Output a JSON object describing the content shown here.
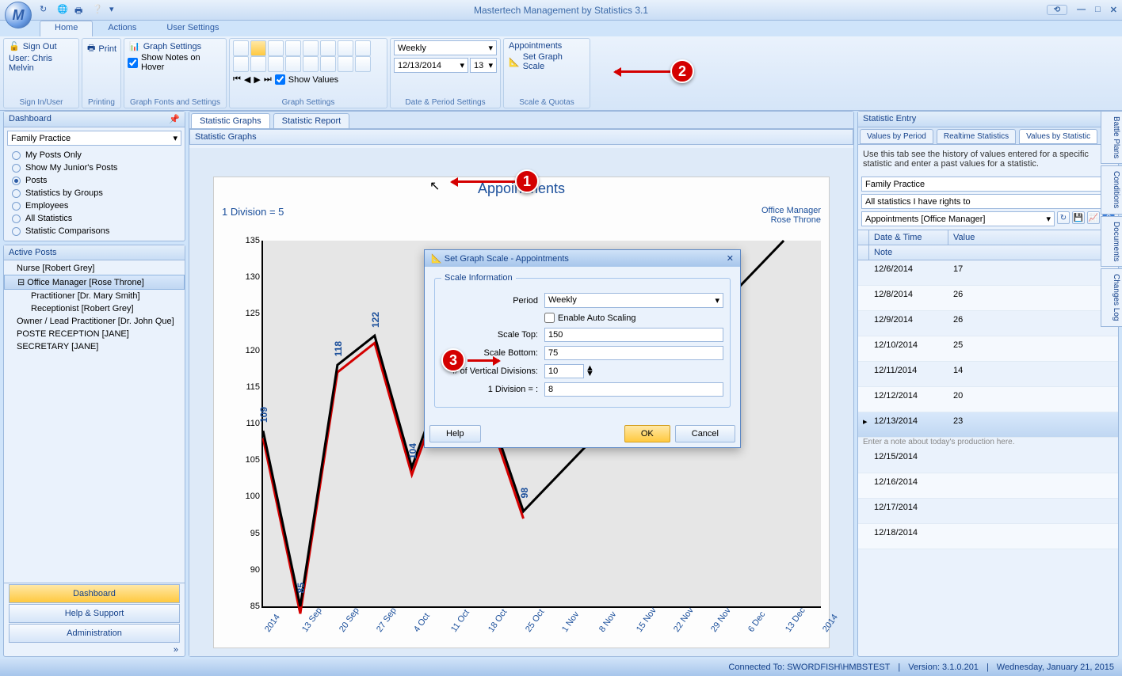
{
  "app": {
    "title": "Mastertech Management by Statistics 3.1",
    "orb": "M"
  },
  "tabs": {
    "home": "Home",
    "actions": "Actions",
    "user_settings": "User Settings"
  },
  "ribbon": {
    "sign_out": "Sign Out",
    "user_line": "User: Chris Melvin",
    "sign_in_grp": "Sign In/User",
    "print": "Print",
    "printing_grp": "Printing",
    "graph_settings": "Graph Settings",
    "show_notes": "Show Notes on Hover",
    "fonts_grp": "Graph Fonts and Settings",
    "show_values": "Show Values",
    "graph_set_grp": "Graph Settings",
    "period_combo": "Weekly",
    "date_val": "12/13/2014",
    "date_num": "13",
    "date_grp": "Date & Period Settings",
    "appts": "Appointments",
    "set_scale": "Set Graph Scale",
    "scale_grp": "Scale & Quotas"
  },
  "dashboard": {
    "title": "Dashboard",
    "combo": "Family Practice",
    "radios": [
      "My Posts Only",
      "Show My Junior's Posts",
      "Posts",
      "Statistics by Groups",
      "Employees",
      "All Statistics",
      "Statistic Comparisons"
    ],
    "radio_selected": 2,
    "active_posts": "Active Posts",
    "tree": [
      {
        "label": "Nurse [Robert Grey]",
        "indent": 0
      },
      {
        "label": "Office Manager [Rose Throne]",
        "indent": 0,
        "sel": true,
        "expand": true
      },
      {
        "label": "Practitioner  [Dr. Mary Smith]",
        "indent": 1
      },
      {
        "label": "Receptionist  [Robert Grey]",
        "indent": 1
      },
      {
        "label": "Owner / Lead Practitioner  [Dr. John Que]",
        "indent": 0
      },
      {
        "label": "POSTE RECEPTION [JANE]",
        "indent": 0
      },
      {
        "label": "SECRETARY [JANE]",
        "indent": 0
      }
    ],
    "nav": [
      "Dashboard",
      "Help & Support",
      "Administration"
    ]
  },
  "center": {
    "tab1": "Statistic Graphs",
    "tab2": "Statistic Report",
    "hdr": "Statistic Graphs",
    "chart_title": "Appointments",
    "div_text": "1 Division = 5",
    "owner1": "Office Manager",
    "owner2": "Rose Throne"
  },
  "dialog": {
    "title": "Set Graph Scale - Appointments",
    "legend": "Scale Information",
    "period_lbl": "Period",
    "period_val": "Weekly",
    "auto": "Enable Auto Scaling",
    "top_lbl": "Scale Top:",
    "top_val": "150",
    "bot_lbl": "Scale Bottom:",
    "bot_val": "75",
    "div_lbl": "# of Vertical Divisions:",
    "div_val": "10",
    "one_lbl": "1 Division = :",
    "one_val": "8",
    "help": "Help",
    "ok": "OK",
    "cancel": "Cancel"
  },
  "right": {
    "title": "Statistic Entry",
    "tabs": [
      "Values by Period",
      "Realtime Statistics",
      "Values by Statistic"
    ],
    "desc": "Use this tab see the history of values entered for a specific statistic and enter a past values for a statistic.",
    "combo1": "Family Practice",
    "combo2": "All statistics I have rights to",
    "combo3": "Appointments [Office Manager]",
    "col1": "Date & Time",
    "col2": "Value",
    "col3": "Note",
    "rows": [
      {
        "d": "12/6/2014",
        "v": "17"
      },
      {
        "d": "12/8/2014",
        "v": "26"
      },
      {
        "d": "12/9/2014",
        "v": "26"
      },
      {
        "d": "12/10/2014",
        "v": "25"
      },
      {
        "d": "12/11/2014",
        "v": "14"
      },
      {
        "d": "12/12/2014",
        "v": "20"
      },
      {
        "d": "12/13/2014",
        "v": "23",
        "sel": true,
        "note": "Enter a note about today's production here."
      },
      {
        "d": "12/15/2014",
        "v": ""
      },
      {
        "d": "12/16/2014",
        "v": ""
      },
      {
        "d": "12/17/2014",
        "v": ""
      },
      {
        "d": "12/18/2014",
        "v": ""
      }
    ]
  },
  "vtabs": [
    "Battle Plans",
    "Conditions",
    "Documents",
    "Changes Log"
  ],
  "status": {
    "conn": "Connected To: SWORDFISH\\HMBSTEST",
    "ver": "Version: 3.1.0.201",
    "date": "Wednesday, January 21, 2015"
  },
  "chart_data": {
    "type": "line",
    "title": "Appointments",
    "x_categories": [
      "2014",
      "13 Sep",
      "20 Sep",
      "27 Sep",
      "4 Oct",
      "11 Oct",
      "18 Oct",
      "25 Oct",
      "1 Nov",
      "8 Nov",
      "15 Nov",
      "22 Nov",
      "29 Nov",
      "6 Dec",
      "13 Dec",
      "2014"
    ],
    "y_ticks": [
      85,
      90,
      95,
      100,
      105,
      110,
      115,
      120,
      125,
      130,
      135
    ],
    "ylim": [
      85,
      135
    ],
    "series": [
      {
        "name": "Appointments",
        "values": [
          109,
          85,
          118,
          122,
          104,
          118,
          113,
          98,
          null,
          null,
          null,
          null,
          null,
          null,
          135
        ],
        "labels": [
          "109",
          "85",
          "118",
          "122",
          "104",
          "118",
          "113",
          "98"
        ]
      }
    ],
    "division_text": "1 Division = 5"
  }
}
